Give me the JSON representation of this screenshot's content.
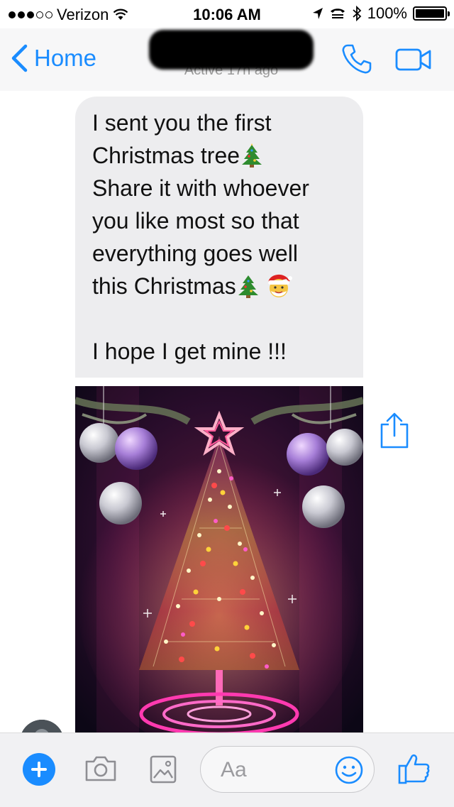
{
  "status_bar": {
    "carrier": "Verizon",
    "time": "10:06 AM",
    "battery": "100%",
    "signal_filled": 3,
    "signal_total": 5
  },
  "nav": {
    "back_label": "Home",
    "subtitle": "Active 17h ago"
  },
  "message": {
    "lines": [
      "I sent you the first",
      "Christmas tree",
      "Share it with whoever",
      "you like most so that",
      "everything goes well",
      "this Christmas"
    ],
    "closing": "I hope I get mine !!!"
  },
  "composer": {
    "placeholder": "Aa"
  },
  "colors": {
    "accent": "#1a8cff",
    "bubble": "#ededef"
  },
  "icons": [
    "chevron-left-icon",
    "phone-icon",
    "video-camera-icon",
    "share-icon",
    "plus-icon",
    "camera-icon",
    "image-icon",
    "smiley-icon",
    "thumbs-up-icon"
  ]
}
